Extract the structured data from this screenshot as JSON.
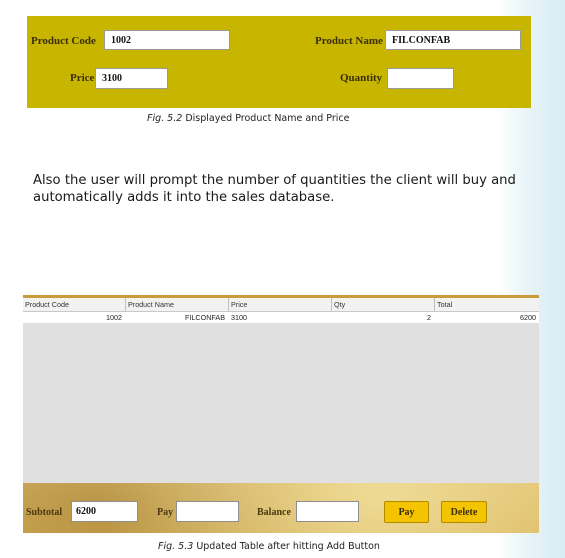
{
  "top_form": {
    "product_code_label": "Product Code",
    "product_code_value": "1002",
    "product_name_label": "Product Name",
    "product_name_value": "FILCONFAB",
    "price_label": "Price",
    "price_value": "3100",
    "quantity_label": "Quantity",
    "quantity_value": ""
  },
  "caption1": {
    "prefix": "Fig. 5.2",
    "text": " Displayed Product Name and Price"
  },
  "paragraph": "Also the user will prompt the number of quantities the client will buy and automatically adds it into the sales database.",
  "table": {
    "columns": [
      "Product Code",
      "Product Name",
      "Price",
      "Qty",
      "Total"
    ],
    "rows": [
      [
        "1002",
        "FILCONFAB",
        "3100",
        "2",
        "6200"
      ]
    ]
  },
  "bottom_bar": {
    "subtotal_label": "Subtotal",
    "subtotal_value": "6200",
    "pay_label": "Pay",
    "pay_value": "",
    "balance_label": "Balance",
    "balance_value": "",
    "pay_button": "Pay",
    "delete_button": "Delete"
  },
  "caption2": {
    "prefix": "Fig. 5.3",
    "text": " Updated Table after hitting Add Button"
  },
  "colors": {
    "form_bg": "#c8b500",
    "button_bg": "#f5c400"
  }
}
